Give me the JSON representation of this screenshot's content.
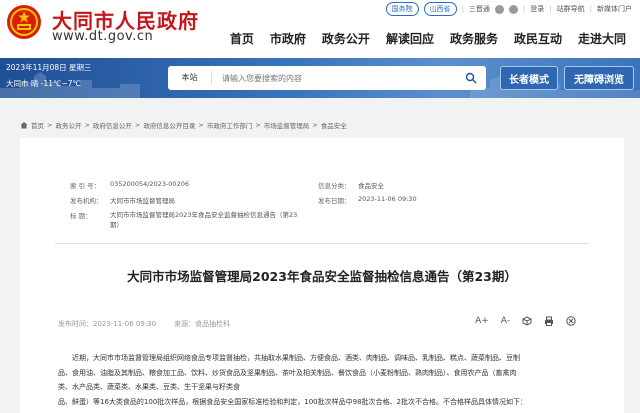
{
  "header": {
    "site_title": "大同市人民政府",
    "site_url": "www.dt.gov.cn",
    "toplinks": {
      "gov_cn": "国务院",
      "shanxi": "山西省",
      "sanqing": "三晋通",
      "login": "登录",
      "register": "站群导航",
      "weibo": "新媒体门户"
    },
    "nav": [
      "首页",
      "市政府",
      "政务公开",
      "解读回应",
      "政务服务",
      "政民互动",
      "走进大同"
    ]
  },
  "banner": {
    "date": "2023年11月08日 星期三",
    "weather": "大同市 晴 -11℃~7℃",
    "search_scope": "本站",
    "search_placeholder": "请输入您要搜索的内容",
    "elder_mode": "长者模式",
    "barrier_free": "无障碍浏览"
  },
  "breadcrumb": [
    "首页",
    "政务公开",
    "政府信息公开",
    "政府信息公开目录",
    "市政府工作部门",
    "市场监督管理局",
    "食品安全"
  ],
  "meta": {
    "index_label": "索 引 号：",
    "index_value": "035200054/2023-00206",
    "category_label": "信息分类：",
    "category_value": "食品安全",
    "org_label": "发布机构：",
    "org_value": "大同市市场监督管理局",
    "date_label": "发布日期：",
    "date_value": "2023-11-06 09:30",
    "title_label": "标    题：",
    "title_value_line1": "大同市市场监督管理局2023年食品安全监督抽检信息通告（第23",
    "title_value_line2": "期）"
  },
  "article": {
    "title": "大同市市场监督管理局2023年食品安全监督抽检信息通告（第23期）",
    "pub_time": "发布时间：2023-11-06 09:30",
    "source": "来源：食品抽检科",
    "font_large": "A+",
    "font_small": "A-",
    "body_line1": "近期，大同市市场监督管理局组织网络食品专项监督抽检，共抽取水果制品、方便食品、酒类、肉制品、调味品、乳制品、糕点、蔬菜制品、豆制",
    "body_line2": "品、食用油、油脂及其制品、粮食加工品、饮料、炒货食品及坚果制品、茶叶及相关制品、餐饮食品（小麦粉制品、熟肉制品）、食用农产品（畜禽肉",
    "body_line3": "类、水产品类、蔬菜类、水果类、豆类、生干坚果与籽类食",
    "body_line4": "品、鲜蛋）等16大类食品的100批次样品，根据食品安全国家标准检验和判定，100批次样品中98批次合格、2批次不合格。不合格样品具体情况如下："
  }
}
